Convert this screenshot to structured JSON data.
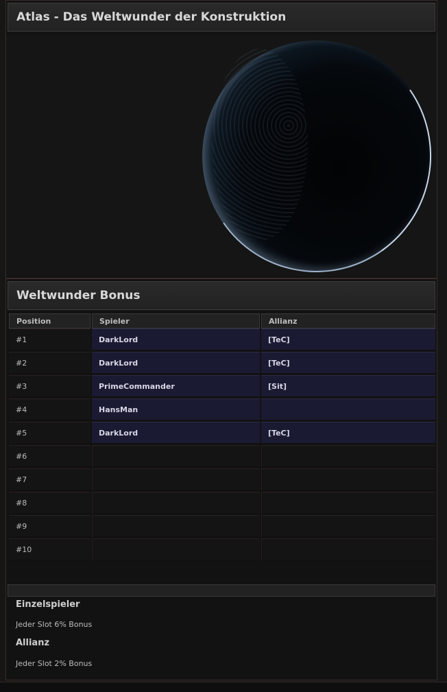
{
  "atlas": {
    "title": "Atlas - Das Weltwunder der Konstruktion"
  },
  "bonus": {
    "title": "Weltwunder Bonus",
    "columns": {
      "position": "Position",
      "player": "Spieler",
      "alliance": "Allianz"
    },
    "rows": [
      {
        "pos": "#1",
        "player": "DarkLord",
        "alliance": "[TeC]"
      },
      {
        "pos": "#2",
        "player": "DarkLord",
        "alliance": "[TeC]"
      },
      {
        "pos": "#3",
        "player": "PrimeCommander",
        "alliance": "[Sit]"
      },
      {
        "pos": "#4",
        "player": "HansMan",
        "alliance": ""
      },
      {
        "pos": "#5",
        "player": "DarkLord",
        "alliance": "[TeC]"
      },
      {
        "pos": "#6",
        "player": "",
        "alliance": ""
      },
      {
        "pos": "#7",
        "player": "",
        "alliance": ""
      },
      {
        "pos": "#8",
        "player": "",
        "alliance": ""
      },
      {
        "pos": "#9",
        "player": "",
        "alliance": ""
      },
      {
        "pos": "#10",
        "player": "",
        "alliance": ""
      }
    ]
  },
  "info": {
    "single_heading": "Einzelspieler",
    "single_text": "Jeder Slot 6% Bonus",
    "alliance_heading": "Allianz",
    "alliance_text": "Jeder Slot 2% Bonus"
  },
  "colors": {
    "filled_row": "#1a1a33",
    "background": "#121212",
    "border": "#3a2a2a"
  }
}
